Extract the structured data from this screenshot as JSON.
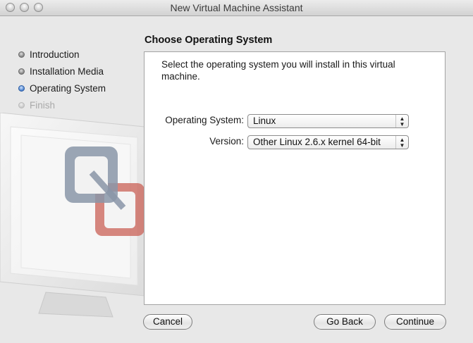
{
  "window": {
    "title": "New Virtual Machine Assistant"
  },
  "steps": [
    {
      "label": "Introduction",
      "state": "done"
    },
    {
      "label": "Installation Media",
      "state": "done"
    },
    {
      "label": "Operating System",
      "state": "current"
    },
    {
      "label": "Finish",
      "state": "pending"
    }
  ],
  "page": {
    "heading": "Choose Operating System",
    "description": "Select the operating system you will install in this virtual machine."
  },
  "form": {
    "os_label": "Operating System:",
    "os_value": "Linux",
    "version_label": "Version:",
    "version_value": "Other Linux 2.6.x kernel 64-bit"
  },
  "buttons": {
    "cancel": "Cancel",
    "back": "Go Back",
    "continue": "Continue"
  },
  "colors": {
    "accent": "#3f78c8",
    "logo_gray": "#8a96a8",
    "logo_red": "#c96055"
  }
}
